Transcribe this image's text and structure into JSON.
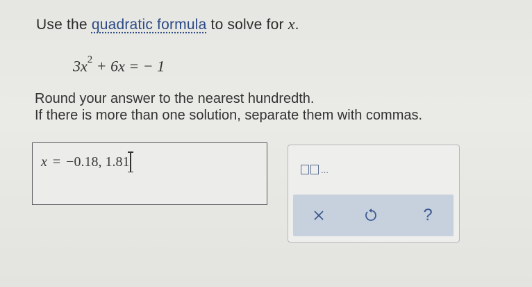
{
  "prompt": {
    "prefix": "Use the",
    "link_text": "quadratic formula",
    "middle": "to solve for",
    "variable": "x",
    "suffix": "."
  },
  "equation": {
    "coef_a": "3x",
    "exponent": "2",
    "rest": "+ 6x = − 1"
  },
  "instructions": {
    "line1": "Round your answer to the nearest hundredth.",
    "line2": "If there is more than one solution, separate them with commas."
  },
  "answer": {
    "variable": "x",
    "equals": "=",
    "value": "−0.18, 1.81"
  },
  "toolbar": {
    "template_label": "...",
    "clear_icon": "close-icon",
    "undo_icon": "undo-icon",
    "help_label": "?"
  },
  "colors": {
    "link": "#2b4a86",
    "action_bar": "#c7d1de",
    "icon": "#3d5a91"
  }
}
